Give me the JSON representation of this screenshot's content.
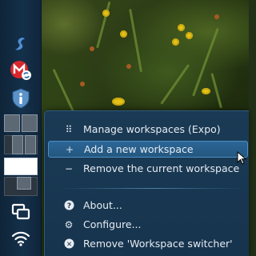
{
  "panel": {
    "launchers": [
      {
        "icon": "steam-icon"
      },
      {
        "icon": "mega-sync-icon"
      },
      {
        "icon": "info-shield-icon"
      }
    ],
    "pager": {
      "workspace_count": 4,
      "active_index": 2
    },
    "bottom_icons": [
      {
        "icon": "window-switcher-icon"
      },
      {
        "icon": "wifi-icon"
      }
    ]
  },
  "context_menu": {
    "items": [
      {
        "icon": "grid-dots-icon",
        "glyph": "⠿",
        "label": "Manage workspaces (Expo)",
        "highlighted": false
      },
      {
        "icon": "plus-icon",
        "glyph": "+",
        "label": "Add a new workspace",
        "highlighted": true
      },
      {
        "icon": "minus-icon",
        "glyph": "−",
        "label": "Remove the current workspace",
        "highlighted": false
      },
      {
        "icon": "help-icon",
        "glyph": "?",
        "label": "About...",
        "highlighted": false
      },
      {
        "icon": "configure-icon",
        "glyph": "⚙",
        "label": "Configure...",
        "highlighted": false
      },
      {
        "icon": "remove-circle-icon",
        "glyph": "✕",
        "label": "Remove 'Workspace switcher'",
        "highlighted": false
      }
    ]
  },
  "colors": {
    "panel_bg": "#14304a",
    "menu_bg": "#1a3a55",
    "highlight": "#2c6596",
    "text": "#e6ecf1"
  }
}
